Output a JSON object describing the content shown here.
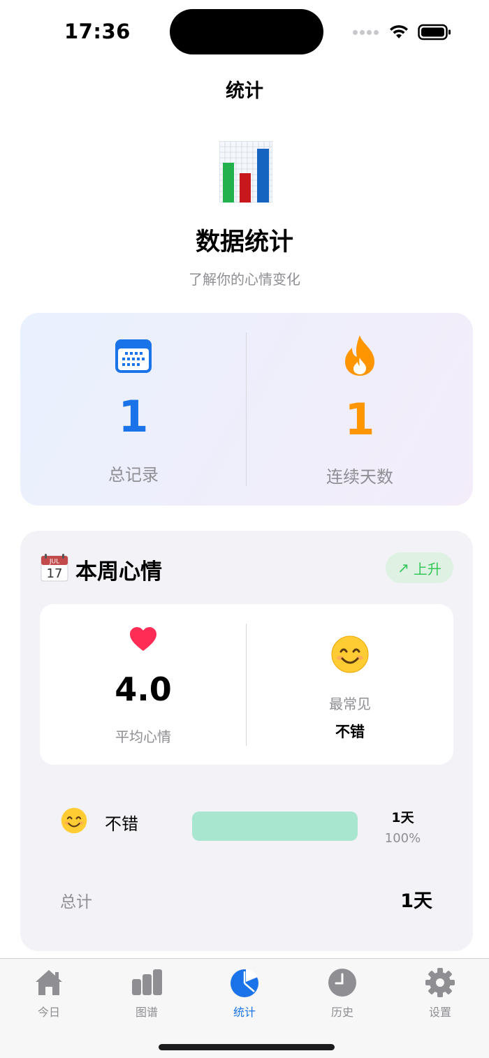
{
  "status_bar": {
    "time": "17:36"
  },
  "nav": {
    "title": "统计"
  },
  "hero": {
    "title": "数据统计",
    "subtitle": "了解你的心情变化"
  },
  "summary": {
    "total_records": {
      "value": "1",
      "label": "总记录",
      "color": "#1a73e8",
      "icon": "calendar-icon"
    },
    "streak_days": {
      "value": "1",
      "label": "连续天数",
      "color": "#ff9500",
      "icon": "flame-icon"
    }
  },
  "week": {
    "icon": "calendar-date-icon",
    "icon_text": {
      "month": "JUL",
      "day": "17"
    },
    "title": "本周心情",
    "trend": {
      "arrow": "↗",
      "label": "上升",
      "color": "#34c759"
    },
    "average": {
      "icon": "heart-icon",
      "value": "4.0",
      "label": "平均心情"
    },
    "most_common": {
      "icon": "smile-emoji-icon",
      "label": "最常见",
      "value": "不错"
    },
    "moods": [
      {
        "icon": "smile-emoji-icon",
        "name": "不错",
        "count": "1天",
        "percent": "100%",
        "fill": 1.0,
        "color": "#a8e6cf"
      }
    ],
    "total_label": "总计",
    "total_value": "1天"
  },
  "tabs": [
    {
      "label": "今日",
      "icon": "house-icon",
      "active": false
    },
    {
      "label": "图谱",
      "icon": "bar-chart-icon",
      "active": false
    },
    {
      "label": "统计",
      "icon": "pie-chart-icon",
      "active": true
    },
    {
      "label": "历史",
      "icon": "clock-icon",
      "active": false
    },
    {
      "label": "设置",
      "icon": "gear-icon",
      "active": false
    }
  ]
}
